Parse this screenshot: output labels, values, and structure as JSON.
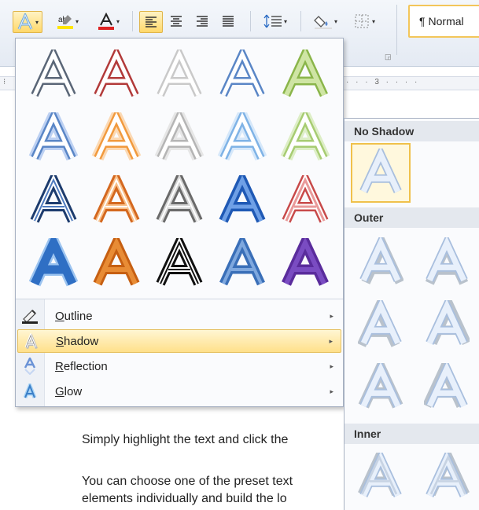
{
  "ribbon": {
    "style_label": "Normal",
    "style_mark": "¶",
    "launcher_glyph": "◲",
    "para_mark": "¶"
  },
  "ruler": {
    "marks": "· · · 3 · · · ·"
  },
  "menu": {
    "gallery_letter": "A",
    "gallery": [
      [
        "outline-gray",
        "outline-red",
        "outline-lightgray",
        "outline-blue",
        "outline-green"
      ],
      [
        "glow-blue",
        "glow-orange",
        "glow-gray",
        "glow-lightblue",
        "glow-green"
      ],
      [
        "bevel-navy",
        "bevel-orange",
        "bevel-silver",
        "bevel-blue",
        "bevel-red"
      ],
      [
        "fill-blue",
        "fill-orange",
        "fill-black",
        "fill-blue-reflect",
        "fill-purple"
      ]
    ],
    "items": [
      {
        "label_first": "O",
        "label_rest": "utline",
        "icon": "outline-pen-icon"
      },
      {
        "label_first": "S",
        "label_rest": "hadow",
        "icon": "shadow-a-icon"
      },
      {
        "label_first": "R",
        "label_rest": "eflection",
        "icon": "reflection-a-icon"
      },
      {
        "label_first": "G",
        "label_rest": "low",
        "icon": "glow-a-icon"
      }
    ],
    "active_item": "Shadow",
    "submenu_arrow": "▸"
  },
  "submenu": {
    "sections": [
      {
        "title": "No Shadow"
      },
      {
        "title": "Outer"
      },
      {
        "title": "Inner"
      }
    ],
    "selected": "No Shadow"
  },
  "document": {
    "lines": [
      "Simply highlight the text and click the",
      "You can choose one of the preset text",
      "elements individually and build the lo"
    ]
  },
  "colors": {
    "accent_hover": "#ffe08a",
    "menu_border": "#a7b1c2",
    "section_header_bg": "#e4e8ee"
  }
}
